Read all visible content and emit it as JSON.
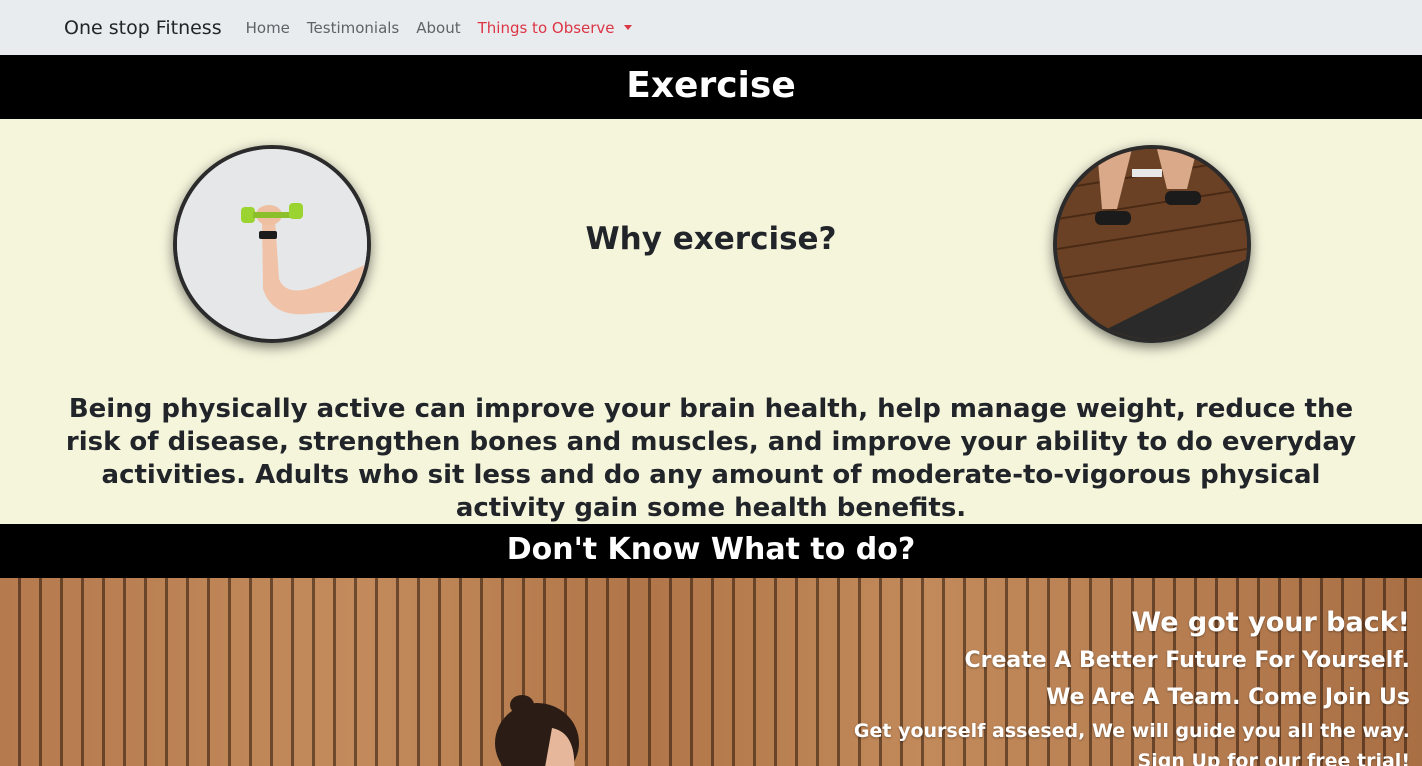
{
  "navbar": {
    "brand": "One stop Fitness",
    "links": [
      "Home",
      "Testimonials",
      "About",
      "Things to Observe"
    ]
  },
  "exercise_header": "Exercise",
  "intro": {
    "question": "Why exercise?",
    "paragraph": "Being physically active can improve your brain health, help manage weight, reduce the risk of disease, strengthen bones and muscles, and improve your ability to do everyday activities. Adults who sit less and do any amount of moderate-to-vigorous physical activity gain some health benefits."
  },
  "section_header": "Don't Know What to do?",
  "hero": {
    "line1": "We got your back!",
    "line2": "Create A Better Future For Yourself.",
    "line3": "We Are A Team. Come Join Us",
    "line4": "Get yourself assesed, We will guide you all the way.",
    "line5": "Sign Up for our free trial!"
  },
  "colors": {
    "navbar_bg": "#e9ecef",
    "active_link": "#dc3545",
    "cream_bg": "#f5f5dc",
    "header_bg": "#000000"
  }
}
